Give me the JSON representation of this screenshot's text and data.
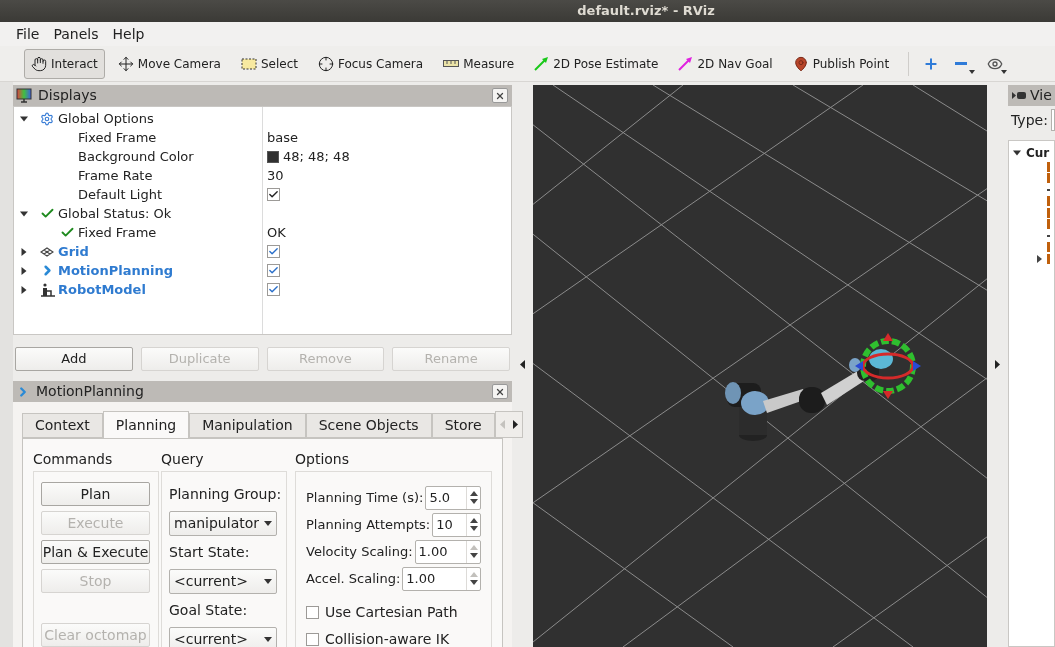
{
  "window": {
    "title": "default.rviz* - RViz"
  },
  "menu": [
    {
      "label": "File"
    },
    {
      "label": "Panels"
    },
    {
      "label": "Help"
    }
  ],
  "toolbar": {
    "tools": [
      {
        "label": "Interact",
        "kind": "interact",
        "selected": true
      },
      {
        "label": "Move Camera",
        "kind": "move",
        "selected": false
      },
      {
        "label": "Select",
        "kind": "select",
        "selected": false
      },
      {
        "label": "Focus Camera",
        "kind": "focus",
        "selected": false
      },
      {
        "label": "Measure",
        "kind": "measure",
        "selected": false
      },
      {
        "label": "2D Pose Estimate",
        "kind": "pose",
        "selected": false
      },
      {
        "label": "2D Nav Goal",
        "kind": "goal",
        "selected": false
      },
      {
        "label": "Publish Point",
        "kind": "point",
        "selected": false
      }
    ],
    "view_controls": [
      {
        "kind": "plus",
        "dropdown": false
      },
      {
        "kind": "minus",
        "dropdown": true
      },
      {
        "kind": "eye",
        "dropdown": true
      }
    ]
  },
  "displays": {
    "title": "Displays",
    "tree": [
      {
        "label": "Global Options",
        "kind": "options",
        "expanded": true,
        "children": [
          {
            "label": "Fixed Frame",
            "kind": "text",
            "value": "base"
          },
          {
            "label": "Background Color",
            "kind": "color",
            "value": "48; 48; 48"
          },
          {
            "label": "Frame Rate",
            "kind": "text",
            "value": "30"
          },
          {
            "label": "Default Light",
            "kind": "checkbox",
            "checked": true
          }
        ]
      },
      {
        "label": "Global Status: Ok",
        "kind": "status",
        "expanded": true,
        "children": [
          {
            "label": "Fixed Frame",
            "kind": "status",
            "value": "OK"
          }
        ]
      },
      {
        "label": "Grid",
        "kind": "grid",
        "expanded": false,
        "enabled": true
      },
      {
        "label": "MotionPlanning",
        "kind": "motion",
        "expanded": false,
        "enabled": true
      },
      {
        "label": "RobotModel",
        "kind": "robot",
        "expanded": false,
        "enabled": true
      }
    ],
    "buttons": [
      {
        "label": "Add",
        "disabled": false
      },
      {
        "label": "Duplicate",
        "disabled": true
      },
      {
        "label": "Remove",
        "disabled": true
      },
      {
        "label": "Rename",
        "disabled": true
      }
    ]
  },
  "motion_planning": {
    "title": "MotionPlanning",
    "tabs": [
      {
        "label": "Context",
        "selected": false
      },
      {
        "label": "Planning",
        "selected": true
      },
      {
        "label": "Manipulation",
        "selected": false
      },
      {
        "label": "Scene Objects",
        "selected": false
      },
      {
        "label": "Store",
        "selected": false
      }
    ],
    "commands": {
      "title": "Commands",
      "buttons": [
        {
          "label": "Plan",
          "disabled": false
        },
        {
          "label": "Execute",
          "disabled": true
        },
        {
          "label": "Plan & Execute",
          "disabled": false
        },
        {
          "label": "Stop",
          "disabled": true
        },
        {
          "label": "Clear octomap",
          "disabled": true
        }
      ]
    },
    "query": {
      "title": "Query",
      "fields": [
        {
          "label": "Planning Group:",
          "value": "manipulator"
        },
        {
          "label": "Start State:",
          "value": "<current>"
        },
        {
          "label": "Goal State:",
          "value": "<current>"
        }
      ]
    },
    "options": {
      "title": "Options",
      "spinboxes": [
        {
          "label": "Planning Time (s):",
          "value": "5.0",
          "up_disabled": false
        },
        {
          "label": "Planning Attempts:",
          "value": "10",
          "up_disabled": false
        },
        {
          "label": "Velocity Scaling:",
          "value": "1.00",
          "up_disabled": true
        },
        {
          "label": "Accel. Scaling:",
          "value": "1.00",
          "up_disabled": true
        }
      ],
      "checkboxes": [
        {
          "label": "Use Cartesian Path",
          "checked": false
        },
        {
          "label": "Collision-aware IK",
          "checked": false
        }
      ]
    }
  },
  "views": {
    "title": "Vie",
    "type_label": "Type:",
    "tree": [
      {
        "label": "Cur",
        "expanded": true,
        "children": [
          {
            "kind": "property",
            "expandable": false
          },
          {
            "kind": "property",
            "expandable": false
          },
          {
            "kind": "text",
            "expandable": false
          },
          {
            "kind": "property",
            "expandable": false
          },
          {
            "kind": "property",
            "expandable": false
          },
          {
            "kind": "property",
            "expandable": false
          },
          {
            "kind": "text",
            "expandable": false
          },
          {
            "kind": "property",
            "expandable": false
          },
          {
            "kind": "property",
            "expandable": true
          }
        ]
      }
    ]
  }
}
